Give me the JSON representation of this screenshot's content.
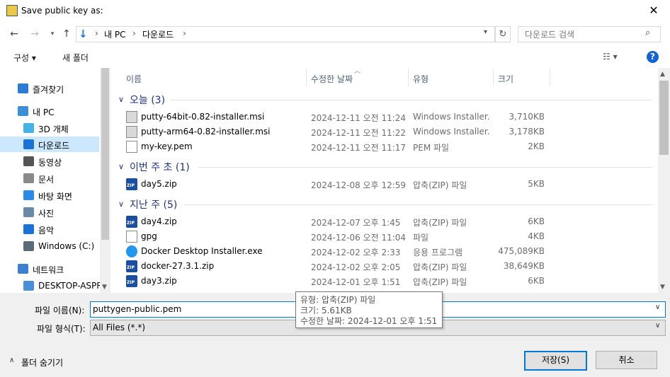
{
  "window": {
    "title": "Save public key as:",
    "close": "✕"
  },
  "address": {
    "path": [
      "내 PC",
      "다운로드"
    ],
    "search_placeholder": "다운로드 검색"
  },
  "toolbar": {
    "organize": "구성 ▾",
    "new_folder": "새 폴더"
  },
  "sidebar": {
    "items": [
      {
        "label": "즐겨찾기",
        "icon": "star-icon"
      },
      {
        "label": "내 PC",
        "icon": "pc-icon"
      },
      {
        "label": "3D 개체",
        "icon": "cube-icon"
      },
      {
        "label": "다운로드",
        "icon": "download-icon",
        "selected": true
      },
      {
        "label": "동영상",
        "icon": "video-icon"
      },
      {
        "label": "문서",
        "icon": "document-icon"
      },
      {
        "label": "바탕 화면",
        "icon": "desktop-icon"
      },
      {
        "label": "사진",
        "icon": "picture-icon"
      },
      {
        "label": "음악",
        "icon": "music-icon"
      },
      {
        "label": "Windows (C:)",
        "icon": "drive-icon"
      },
      {
        "label": "네트워크",
        "icon": "network-icon"
      },
      {
        "label": "DESKTOP-ASPR",
        "icon": "computer-icon"
      }
    ]
  },
  "columns": {
    "name": "이름",
    "date": "수정한 날짜",
    "type": "유형",
    "size": "크기"
  },
  "groups": [
    {
      "label": "오늘 (3)",
      "files": [
        {
          "name": "putty-64bit-0.82-installer.msi",
          "date": "2024-12-11 오전 11:24",
          "type": "Windows Installer...",
          "size": "3,710KB",
          "icon": "msi"
        },
        {
          "name": "putty-arm64-0.82-installer.msi",
          "date": "2024-12-11 오전 11:22",
          "type": "Windows Installer...",
          "size": "3,178KB",
          "icon": "msi"
        },
        {
          "name": "my-key.pem",
          "date": "2024-12-11 오전 11:17",
          "type": "PEM 파일",
          "size": "2KB",
          "icon": "pem"
        }
      ]
    },
    {
      "label": "이번 주 초 (1)",
      "files": [
        {
          "name": "day5.zip",
          "date": "2024-12-08 오후 12:59",
          "type": "압축(ZIP) 파일",
          "size": "5KB",
          "icon": "zip"
        }
      ]
    },
    {
      "label": "지난 주 (5)",
      "files": [
        {
          "name": "day4.zip",
          "date": "2024-12-07 오후 1:45",
          "type": "압축(ZIP) 파일",
          "size": "6KB",
          "icon": "zip"
        },
        {
          "name": "gpg",
          "date": "2024-12-06 오전 11:04",
          "type": "파일",
          "size": "4KB",
          "icon": "pem"
        },
        {
          "name": "Docker Desktop Installer.exe",
          "date": "2024-12-02 오후 2:33",
          "type": "응용 프로그램",
          "size": "475,089KB",
          "icon": "exe"
        },
        {
          "name": "docker-27.3.1.zip",
          "date": "2024-12-02 오후 2:05",
          "type": "압축(ZIP) 파일",
          "size": "38,649KB",
          "icon": "zip"
        },
        {
          "name": "day3.zip",
          "date": "2024-12-01 오후 1:51",
          "type": "압축(ZIP) 파일",
          "size": "6KB",
          "icon": "zip"
        }
      ]
    }
  ],
  "tooltip": {
    "type": "유형: 압축(ZIP) 파일",
    "size": "크기: 5.61KB",
    "date": "수정한 날짜: 2024-12-01 오후 1:51"
  },
  "bottom": {
    "filename_label": "파일 이름(N):",
    "filename_value": "puttygen-public.pem",
    "filetype_label": "파일 형식(T):",
    "filetype_value": "All Files (*.*)",
    "hide_folders": "폴더 숨기기",
    "save": "저장(S)",
    "cancel": "취소"
  }
}
